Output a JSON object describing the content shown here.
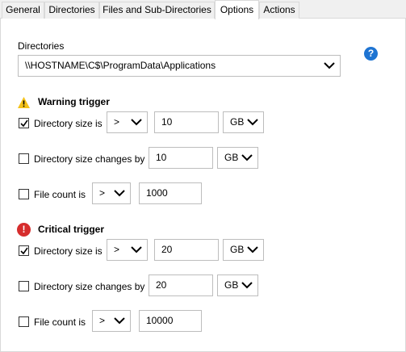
{
  "tabs": [
    "General",
    "Directories",
    "Files and Sub-Directories",
    "Options",
    "Actions"
  ],
  "active_tab": "Options",
  "directories": {
    "label": "Directories",
    "value": "\\\\HOSTNAME\\C$\\ProgramData\\Applications"
  },
  "warning": {
    "title": "Warning trigger",
    "size": {
      "label": "Directory size is",
      "checked": true,
      "operator": ">",
      "value": "10",
      "unit": "GB"
    },
    "changes": {
      "label": "Directory size changes by",
      "checked": false,
      "value": "10",
      "unit": "GB"
    },
    "count": {
      "label": "File count is",
      "checked": false,
      "operator": ">",
      "value": "1000"
    }
  },
  "critical": {
    "title": "Critical trigger",
    "size": {
      "label": "Directory size is",
      "checked": true,
      "operator": ">",
      "value": "20",
      "unit": "GB"
    },
    "changes": {
      "label": "Directory size changes by",
      "checked": false,
      "value": "20",
      "unit": "GB"
    },
    "count": {
      "label": "File count is",
      "checked": false,
      "operator": ">",
      "value": "10000"
    }
  },
  "colors": {
    "help": "#1e74d2",
    "warning": "#f4c21a",
    "critical": "#d62d2d",
    "accent": "#0078d7"
  }
}
